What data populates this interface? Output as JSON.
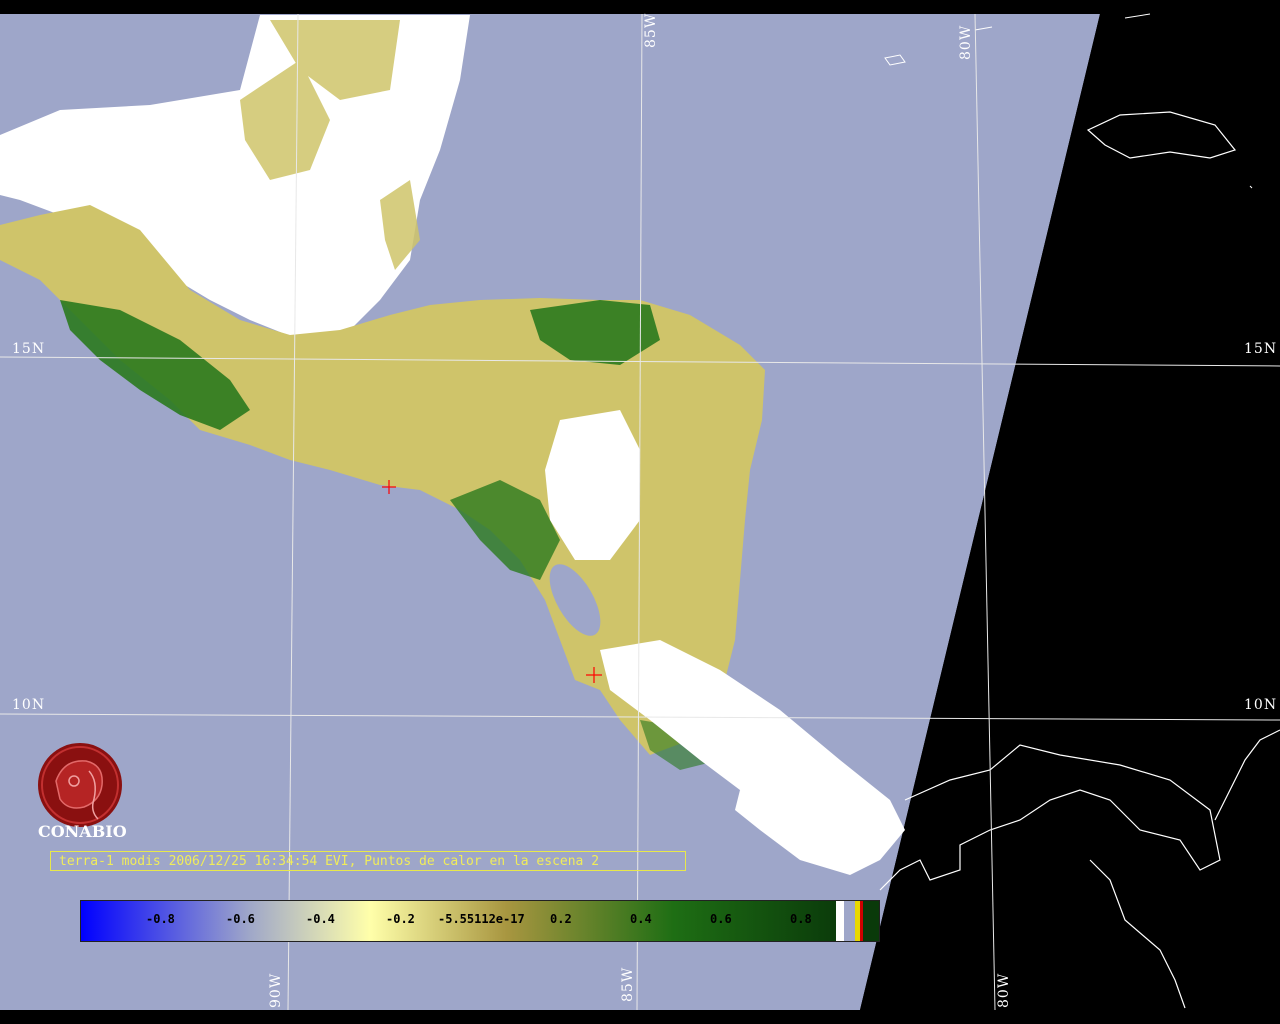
{
  "grid_labels": {
    "lat_15_left": "15N",
    "lat_15_right": "15N",
    "lat_10_left": "10N",
    "lat_10_right": "10N",
    "lon_85_top": "85W",
    "lon_80_top": "80W",
    "lon_90_bottom": "90W",
    "lon_85_bottom": "85W",
    "lon_80_bottom": "80W"
  },
  "logo": {
    "name": "CONABIO"
  },
  "caption": "terra-1 modis 2006/12/25 16:34:54 EVI, Puntos de calor en la escena 2",
  "colorbar": {
    "ticks": [
      "-0.8",
      "-0.6",
      "-0.4",
      "-0.2",
      "-5.55112e-17",
      "0.2",
      "0.4",
      "0.6",
      "0.8"
    ],
    "colors": [
      "#0000ff",
      "#9ea6c9",
      "#ffffaa",
      "#a89640",
      "#1e6e14",
      "#0a3a0a"
    ]
  },
  "colors": {
    "ocean": "#9ea6c9",
    "cloud": "#ffffff",
    "vegetation_low": "#cfc46a",
    "vegetation_high": "#2a7a1e",
    "no_data": "#000000",
    "hotspot_marker": "#ff0000"
  }
}
